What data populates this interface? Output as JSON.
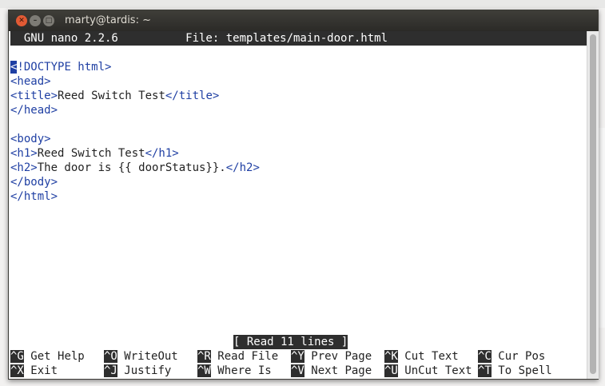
{
  "window": {
    "title": "marty@tardis: ~"
  },
  "nano": {
    "header": "  GNU nano 2.2.6          File: templates/main-door.html",
    "status_message": "[ Read 11 lines ]",
    "lines": [
      {
        "tag1": "<!DOCTYPE html>",
        "text": "",
        "tag2": ""
      },
      {
        "tag1": "<head>",
        "text": "",
        "tag2": ""
      },
      {
        "tag1": "<title>",
        "text": "Reed Switch Test",
        "tag2": "</title>"
      },
      {
        "tag1": "</head>",
        "text": "",
        "tag2": ""
      },
      {
        "tag1": "",
        "text": "",
        "tag2": ""
      },
      {
        "tag1": "<body>",
        "text": "",
        "tag2": ""
      },
      {
        "tag1": "<h1>",
        "text": "Reed Switch Test",
        "tag2": "</h1>"
      },
      {
        "tag1": "<h2>",
        "text": "The door is {{ doorStatus}}.",
        "tag2": "</h2>"
      },
      {
        "tag1": "</body>",
        "text": "",
        "tag2": ""
      },
      {
        "tag1": "</html>",
        "text": "",
        "tag2": ""
      }
    ],
    "shortcuts_row1": [
      {
        "key": "^G",
        "label": "Get Help"
      },
      {
        "key": "^O",
        "label": "WriteOut"
      },
      {
        "key": "^R",
        "label": "Read File"
      },
      {
        "key": "^Y",
        "label": "Prev Page"
      },
      {
        "key": "^K",
        "label": "Cut Text"
      },
      {
        "key": "^C",
        "label": "Cur Pos"
      }
    ],
    "shortcuts_row2": [
      {
        "key": "^X",
        "label": "Exit"
      },
      {
        "key": "^J",
        "label": "Justify"
      },
      {
        "key": "^W",
        "label": "Where Is"
      },
      {
        "key": "^V",
        "label": "Next Page"
      },
      {
        "key": "^U",
        "label": "UnCut Text"
      },
      {
        "key": "^T",
        "label": "To Spell"
      }
    ]
  },
  "icons": {
    "close": "close-icon",
    "minimize": "minimize-icon",
    "maximize": "maximize-icon"
  },
  "colors": {
    "tag": "#1f3fa3",
    "terminal_bg": "#ffffff",
    "bar_bg": "#2e2e2e",
    "titlebar_bg": "#3c3b37",
    "close_button": "#e25a34"
  }
}
